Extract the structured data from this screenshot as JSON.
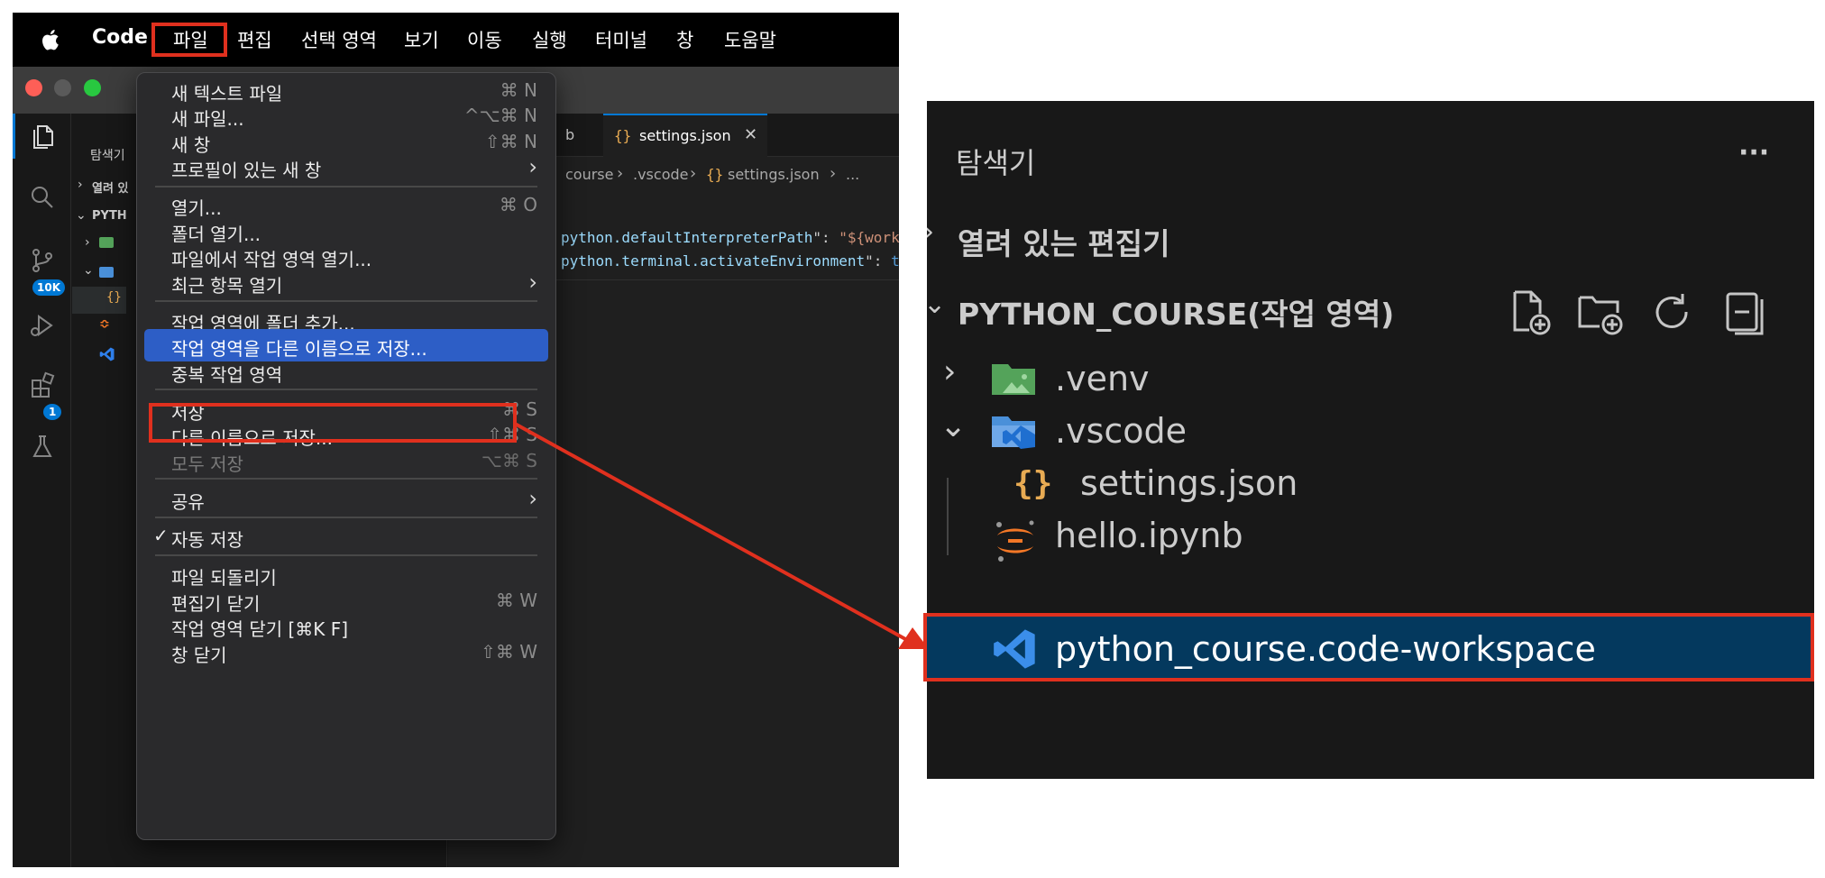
{
  "menubar": {
    "app_name": "Code",
    "items": [
      "파일",
      "편집",
      "선택 영역",
      "보기",
      "이동",
      "실행",
      "터미널",
      "창",
      "도움말"
    ]
  },
  "activity_bar": {
    "scm_badge": "10K",
    "extensions_badge": "1"
  },
  "sidebar": {
    "title": "탐색기",
    "open_editors": "열려 있",
    "workspace": "PYTH"
  },
  "editor": {
    "tab_partial": "b",
    "tab_active": "settings.json",
    "breadcrumb": {
      "part1": "course",
      "part2": ".vscode",
      "part3": "settings.json",
      "part4": "..."
    },
    "lines": [
      {
        "key": "python.defaultInterpreterPath",
        "sep": ": ",
        "val": "\"${work"
      },
      {
        "key": "python.terminal.activateEnvironment",
        "sep": ": ",
        "val": "t"
      }
    ]
  },
  "file_menu": {
    "items": [
      {
        "label": "새 텍스트 파일",
        "shortcut": "⌘ N"
      },
      {
        "label": "새 파일...",
        "shortcut": "^⌥⌘ N"
      },
      {
        "label": "새 창",
        "shortcut": "⇧⌘ N"
      },
      {
        "label": "프로필이 있는 새 창",
        "submenu": true
      },
      {
        "label": "열기...",
        "shortcut": "⌘ O"
      },
      {
        "label": "폴더 열기..."
      },
      {
        "label": "파일에서 작업 영역 열기..."
      },
      {
        "label": "최근 항목 열기",
        "submenu": true
      },
      {
        "label": "작업 영역에 폴더 추가..."
      },
      {
        "label": "작업 영역을 다른 이름으로 저장...",
        "selected": true
      },
      {
        "label": "중복 작업 영역"
      },
      {
        "label": "저장",
        "shortcut": "⌘ S"
      },
      {
        "label": "다른 이름으로 저장...",
        "shortcut": "⇧⌘ S"
      },
      {
        "label": "모두 저장",
        "shortcut": "⌥⌘ S",
        "disabled": true
      },
      {
        "label": "공유",
        "submenu": true
      },
      {
        "label": "자동 저장",
        "checked": true
      },
      {
        "label": "파일 되돌리기"
      },
      {
        "label": "편집기 닫기",
        "shortcut": "⌘ W"
      },
      {
        "label": "작업 영역 닫기 [⌘K F]"
      },
      {
        "label": "창 닫기",
        "shortcut": "⇧⌘ W"
      }
    ]
  },
  "zoom_explorer": {
    "title": "탐색기",
    "more": "···",
    "open_editors": "열려 있는 편집기",
    "workspace": "PYTHON_COURSE(작업 영역)",
    "tree": [
      {
        "name": ".venv",
        "icon": "folder-green-icon"
      },
      {
        "name": ".vscode",
        "icon": "folder-vscode-icon"
      },
      {
        "name": "settings.json",
        "icon": "json-braces-icon"
      },
      {
        "name": "hello.ipynb",
        "icon": "jupyter-icon"
      },
      {
        "name": "python_course.code-workspace",
        "icon": "vscode-logo-icon",
        "selected": true
      }
    ]
  },
  "colors": {
    "highlight_red": "#e0301e",
    "menu_selection": "#2d5ec6",
    "tree_selection": "#04395e",
    "vscode_blue": "#0078d4"
  }
}
